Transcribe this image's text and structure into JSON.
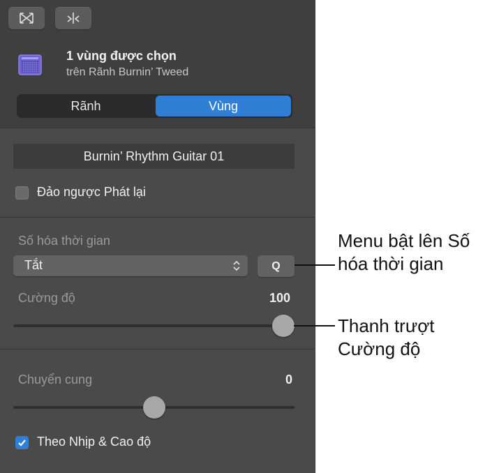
{
  "toolbar": {
    "buttons": [
      {
        "icon": "bowtie-icon"
      },
      {
        "icon": "split-scissors-icon"
      }
    ]
  },
  "region_header": {
    "icon": "amp-icon",
    "title": "1 vùng được chọn",
    "subtitle": "trên Rãnh Burnin’ Tweed"
  },
  "tabs": [
    {
      "label": "Rãnh",
      "active": false
    },
    {
      "label": "Vùng",
      "active": true
    }
  ],
  "region_name": "Burnin’ Rhythm Guitar 01",
  "reverse_playback": {
    "label": "Đảo ngược Phát lại",
    "checked": false
  },
  "quantize": {
    "label": "Số hóa thời gian",
    "value": "Tắt",
    "q_label": "Q"
  },
  "strength": {
    "label": "Cường độ",
    "value": "100",
    "fraction": 1.0
  },
  "transpose": {
    "label": "Chuyển cung",
    "value": "0",
    "fraction": 0.5
  },
  "follow_tempo": {
    "label": "Theo Nhịp & Cao độ",
    "checked": true
  },
  "callouts": {
    "quantize_menu": [
      "Menu bật lên Số",
      "hóa thời gian"
    ],
    "strength_slider": [
      "Thanh trượt",
      "Cường độ"
    ]
  },
  "colors": {
    "accent": "#2f7fd6",
    "panel_bg": "#4a4a4a",
    "amp_icon": "#7b6fd8"
  }
}
